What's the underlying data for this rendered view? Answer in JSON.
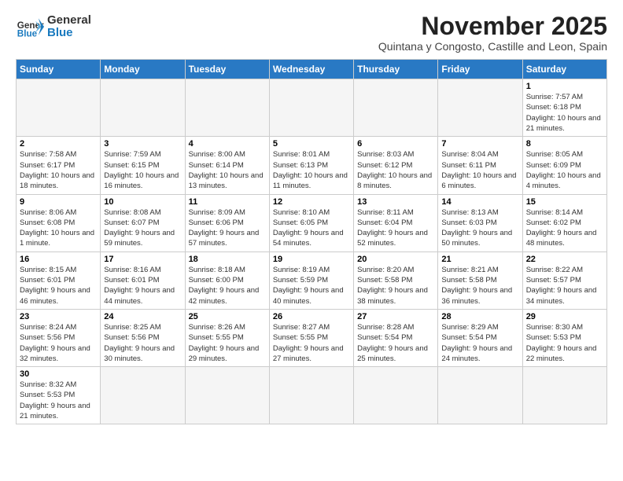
{
  "header": {
    "logo_general": "General",
    "logo_blue": "Blue",
    "month_title": "November 2025",
    "subtitle": "Quintana y Congosto, Castille and Leon, Spain"
  },
  "days_of_week": [
    "Sunday",
    "Monday",
    "Tuesday",
    "Wednesday",
    "Thursday",
    "Friday",
    "Saturday"
  ],
  "weeks": [
    [
      {
        "day": "",
        "empty": true
      },
      {
        "day": "",
        "empty": true
      },
      {
        "day": "",
        "empty": true
      },
      {
        "day": "",
        "empty": true
      },
      {
        "day": "",
        "empty": true
      },
      {
        "day": "",
        "empty": true
      },
      {
        "day": "1",
        "sunrise": "7:57 AM",
        "sunset": "6:18 PM",
        "daylight": "10 hours and 21 minutes."
      }
    ],
    [
      {
        "day": "2",
        "sunrise": "7:58 AM",
        "sunset": "6:17 PM",
        "daylight": "10 hours and 18 minutes."
      },
      {
        "day": "3",
        "sunrise": "7:59 AM",
        "sunset": "6:15 PM",
        "daylight": "10 hours and 16 minutes."
      },
      {
        "day": "4",
        "sunrise": "8:00 AM",
        "sunset": "6:14 PM",
        "daylight": "10 hours and 13 minutes."
      },
      {
        "day": "5",
        "sunrise": "8:01 AM",
        "sunset": "6:13 PM",
        "daylight": "10 hours and 11 minutes."
      },
      {
        "day": "6",
        "sunrise": "8:03 AM",
        "sunset": "6:12 PM",
        "daylight": "10 hours and 8 minutes."
      },
      {
        "day": "7",
        "sunrise": "8:04 AM",
        "sunset": "6:11 PM",
        "daylight": "10 hours and 6 minutes."
      },
      {
        "day": "8",
        "sunrise": "8:05 AM",
        "sunset": "6:09 PM",
        "daylight": "10 hours and 4 minutes."
      }
    ],
    [
      {
        "day": "9",
        "sunrise": "8:06 AM",
        "sunset": "6:08 PM",
        "daylight": "10 hours and 1 minute."
      },
      {
        "day": "10",
        "sunrise": "8:08 AM",
        "sunset": "6:07 PM",
        "daylight": "9 hours and 59 minutes."
      },
      {
        "day": "11",
        "sunrise": "8:09 AM",
        "sunset": "6:06 PM",
        "daylight": "9 hours and 57 minutes."
      },
      {
        "day": "12",
        "sunrise": "8:10 AM",
        "sunset": "6:05 PM",
        "daylight": "9 hours and 54 minutes."
      },
      {
        "day": "13",
        "sunrise": "8:11 AM",
        "sunset": "6:04 PM",
        "daylight": "9 hours and 52 minutes."
      },
      {
        "day": "14",
        "sunrise": "8:13 AM",
        "sunset": "6:03 PM",
        "daylight": "9 hours and 50 minutes."
      },
      {
        "day": "15",
        "sunrise": "8:14 AM",
        "sunset": "6:02 PM",
        "daylight": "9 hours and 48 minutes."
      }
    ],
    [
      {
        "day": "16",
        "sunrise": "8:15 AM",
        "sunset": "6:01 PM",
        "daylight": "9 hours and 46 minutes."
      },
      {
        "day": "17",
        "sunrise": "8:16 AM",
        "sunset": "6:01 PM",
        "daylight": "9 hours and 44 minutes."
      },
      {
        "day": "18",
        "sunrise": "8:18 AM",
        "sunset": "6:00 PM",
        "daylight": "9 hours and 42 minutes."
      },
      {
        "day": "19",
        "sunrise": "8:19 AM",
        "sunset": "5:59 PM",
        "daylight": "9 hours and 40 minutes."
      },
      {
        "day": "20",
        "sunrise": "8:20 AM",
        "sunset": "5:58 PM",
        "daylight": "9 hours and 38 minutes."
      },
      {
        "day": "21",
        "sunrise": "8:21 AM",
        "sunset": "5:58 PM",
        "daylight": "9 hours and 36 minutes."
      },
      {
        "day": "22",
        "sunrise": "8:22 AM",
        "sunset": "5:57 PM",
        "daylight": "9 hours and 34 minutes."
      }
    ],
    [
      {
        "day": "23",
        "sunrise": "8:24 AM",
        "sunset": "5:56 PM",
        "daylight": "9 hours and 32 minutes."
      },
      {
        "day": "24",
        "sunrise": "8:25 AM",
        "sunset": "5:56 PM",
        "daylight": "9 hours and 30 minutes."
      },
      {
        "day": "25",
        "sunrise": "8:26 AM",
        "sunset": "5:55 PM",
        "daylight": "9 hours and 29 minutes."
      },
      {
        "day": "26",
        "sunrise": "8:27 AM",
        "sunset": "5:55 PM",
        "daylight": "9 hours and 27 minutes."
      },
      {
        "day": "27",
        "sunrise": "8:28 AM",
        "sunset": "5:54 PM",
        "daylight": "9 hours and 25 minutes."
      },
      {
        "day": "28",
        "sunrise": "8:29 AM",
        "sunset": "5:54 PM",
        "daylight": "9 hours and 24 minutes."
      },
      {
        "day": "29",
        "sunrise": "8:30 AM",
        "sunset": "5:53 PM",
        "daylight": "9 hours and 22 minutes."
      }
    ],
    [
      {
        "day": "30",
        "sunrise": "8:32 AM",
        "sunset": "5:53 PM",
        "daylight": "9 hours and 21 minutes."
      },
      {
        "day": "",
        "empty": true
      },
      {
        "day": "",
        "empty": true
      },
      {
        "day": "",
        "empty": true
      },
      {
        "day": "",
        "empty": true
      },
      {
        "day": "",
        "empty": true
      },
      {
        "day": "",
        "empty": true
      }
    ]
  ]
}
